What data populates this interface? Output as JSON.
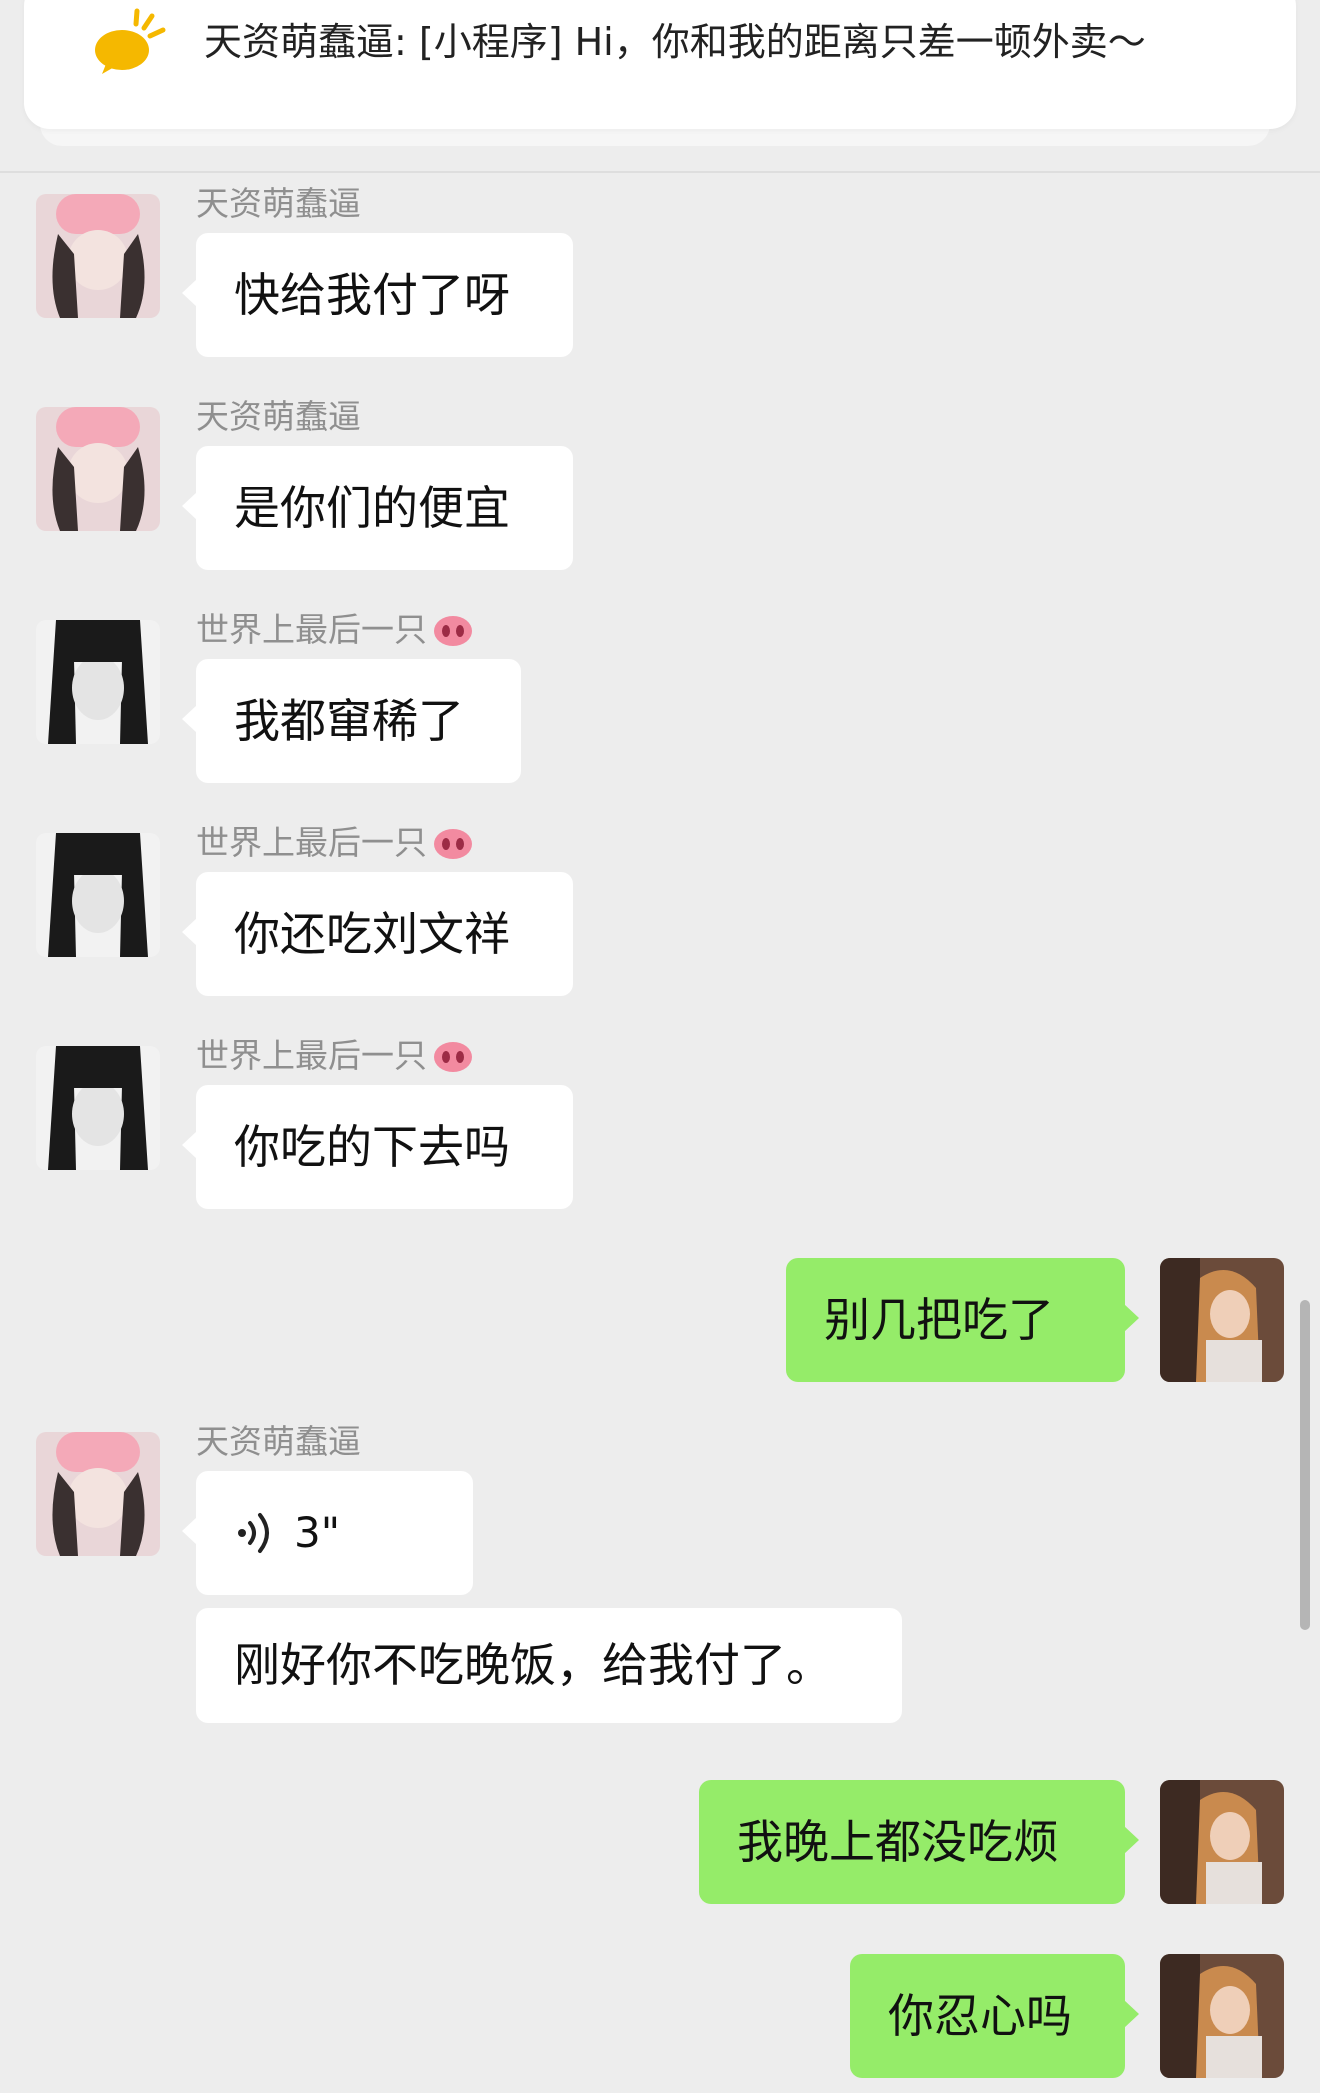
{
  "pinned": {
    "text": "天资萌蠢逼: [小程序] Hi，你和我的距离只差一顿外卖～",
    "icon": "orange-chat-bubble-icon",
    "accent": "#f5b800"
  },
  "colors": {
    "background": "#ededed",
    "incoming_bubble": "#ffffff",
    "outgoing_bubble": "#95ec69",
    "sender_name": "#8f8f8f"
  },
  "messages": [
    {
      "direction": "in",
      "sender": "天资萌蠢逼",
      "avatar": "pink-hat-girl-avatar",
      "text": "快给我付了呀"
    },
    {
      "direction": "in",
      "sender": "天资萌蠢逼",
      "avatar": "pink-hat-girl-avatar",
      "text": "是你们的便宜"
    },
    {
      "direction": "in",
      "sender": "世界上最后一只",
      "sender_emoji": "pig-nose-emoji",
      "avatar": "anime-girl-avatar",
      "text": "我都窜稀了"
    },
    {
      "direction": "in",
      "sender": "世界上最后一只",
      "sender_emoji": "pig-nose-emoji",
      "avatar": "anime-girl-avatar",
      "text": "你还吃刘文祥"
    },
    {
      "direction": "in",
      "sender": "世界上最后一只",
      "sender_emoji": "pig-nose-emoji",
      "avatar": "anime-girl-avatar",
      "text": "你吃的下去吗"
    },
    {
      "direction": "out",
      "avatar": "self-photo-avatar",
      "text": "别几把吃了"
    },
    {
      "direction": "in",
      "sender": "天资萌蠢逼",
      "avatar": "pink-hat-girl-avatar",
      "type": "voice",
      "duration": "3\""
    },
    {
      "direction": "in",
      "type": "text-continuation",
      "text": "刚好你不吃晚饭，给我付了。"
    },
    {
      "direction": "out",
      "avatar": "self-photo-avatar",
      "text": "我晚上都没吃烦"
    },
    {
      "direction": "out",
      "avatar": "self-photo-avatar",
      "text": "你忍心吗"
    }
  ]
}
